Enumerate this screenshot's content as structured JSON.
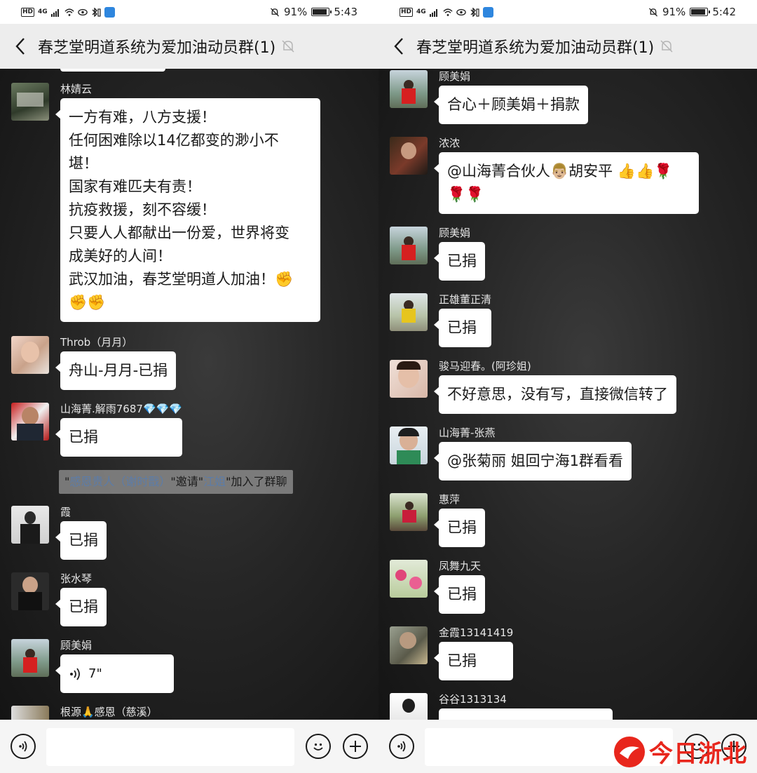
{
  "colors": {
    "header_bg": "#ededed",
    "bubble_bg": "#ffffff",
    "chat_bg_center": "#3a3a3a",
    "chat_bg_edge": "#141414",
    "link": "#5c7ca8",
    "watermark": "#e8261c"
  },
  "left": {
    "status": {
      "hd": "HD",
      "signal": "4G",
      "battery": "91%",
      "battery_level": 0.91,
      "time": "5:43"
    },
    "title": "春芝堂明道系统为爱加油动员群(1)",
    "messages": [
      {
        "sender": "林婧云",
        "lines": [
          "一方有难，八方支援！",
          "任何困难除以14亿都变的渺小不",
          "堪！",
          "国家有难匹夫有责！",
          "抗疫救援，刻不容缓！",
          "只要人人都献出一份爱，世界将变",
          "成美好的人间！",
          "武汉加油，春芝堂明道人加油！✊",
          "✊✊"
        ]
      },
      {
        "sender": "Throb（月月）",
        "text": "舟山-月月-已捐"
      },
      {
        "sender": "山海菁.解雨7687💎💎💎",
        "text": "已捐"
      },
      {
        "sender": "霞",
        "text": "已捐"
      },
      {
        "sender": "张水琴",
        "text": "已捐"
      },
      {
        "sender": "顾美娟",
        "voice_duration": "7\""
      },
      {
        "sender": "根源🙏感恩（慈溪）"
      }
    ],
    "system_notice": {
      "q1": "\"",
      "inviter": "感恩贵人（谢时戬）",
      "mid": "\"邀请\"",
      "invitee": "江姐",
      "tail": "\"加入了群聊"
    }
  },
  "right": {
    "status": {
      "hd": "HD",
      "signal": "4G",
      "battery": "91%",
      "battery_level": 0.91,
      "time": "5:42"
    },
    "title": "春芝堂明道系统为爱加油动员群(1)",
    "messages": [
      {
        "sender": "顾美娟",
        "text": "合心＋顾美娟＋捐款"
      },
      {
        "sender": "浓浓",
        "lines": [
          "@山海菁合伙人👨🏼胡安平 👍👍🌹",
          "🌹🌹"
        ]
      },
      {
        "sender": "顾美娟",
        "text": "已捐"
      },
      {
        "sender": "正雄董正清",
        "text": "已捐"
      },
      {
        "sender": "骏马迎春。(阿珍姐)",
        "text": "不好意思，没有写，直接微信转了"
      },
      {
        "sender": "山海菁-张燕",
        "text": "@张菊丽  姐回宁海1群看看"
      },
      {
        "sender": "惠萍",
        "text": "已捐"
      },
      {
        "sender": "凤舞九天",
        "text": "已捐"
      },
      {
        "sender": "金霞13141419",
        "text": "已捐"
      },
      {
        "sender": "谷谷1313134"
      }
    ]
  },
  "watermark": {
    "text": "今日浙北"
  },
  "icons": {
    "back": "chevron-left-icon",
    "mute": "bell-off-icon",
    "voice": "voice-mode-icon",
    "emoji": "emoji-icon",
    "plus": "plus-icon"
  }
}
